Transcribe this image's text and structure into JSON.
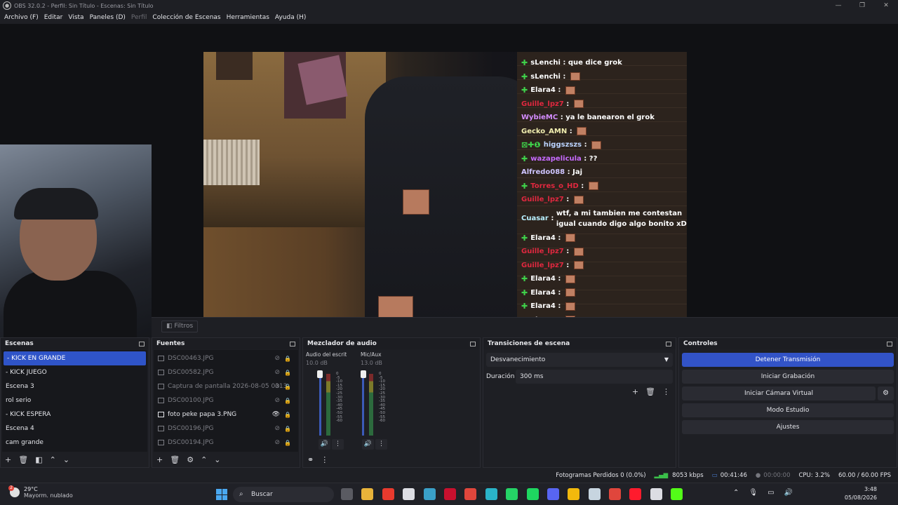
{
  "window": {
    "title": "OBS 32.0.2 - Perfil: Sin Título - Escenas: Sin Título",
    "controls": [
      "—",
      "❐",
      "✕"
    ]
  },
  "menu": {
    "items": [
      "Archivo (F)",
      "Editar",
      "Vista",
      "Paneles (D)",
      "Perfil",
      "Colección de Escenas",
      "Herramientas",
      "Ayuda (H)"
    ]
  },
  "chat": {
    "lines": [
      {
        "user": "sLenchi",
        "msg": "que dice grok",
        "color": "#ffffff",
        "badge": "✚",
        "emote": false
      },
      {
        "user": "sLenchi",
        "msg": "",
        "color": "#ffffff",
        "badge": "✚",
        "emote": true
      },
      {
        "user": "Elara4",
        "msg": "",
        "color": "#ffffff",
        "badge": "✚",
        "emote": true
      },
      {
        "user": "Guille_lpz7",
        "msg": "",
        "color": "#e0283f",
        "badge": "",
        "emote": true
      },
      {
        "user": "WybieMC",
        "msg": "ya le banearon el grok",
        "color": "#d48cff",
        "badge": "",
        "emote": false
      },
      {
        "user": "Gecko_AMN",
        "msg": "",
        "color": "#f2efb0",
        "badge": "",
        "emote": true
      },
      {
        "user": "higgszszs",
        "msg": "",
        "color": "#bcd4ff",
        "badge": "⊠✚❶",
        "emote": true
      },
      {
        "user": "wazapelicula",
        "msg": "??",
        "color": "#c76bff",
        "badge": "✚",
        "emote": false
      },
      {
        "user": "Alfredo088",
        "msg": "Jaj",
        "color": "#cfc5ff",
        "badge": "",
        "emote": false
      },
      {
        "user": "Torres_o_HD",
        "msg": "",
        "color": "#e0283f",
        "badge": "✚",
        "emote": true
      },
      {
        "user": "Guille_lpz7",
        "msg": "",
        "color": "#e0283f",
        "badge": "",
        "emote": true
      },
      {
        "user": "Cuasar",
        "msg": "wtf, a mi tambien me contestan igual cuando digo algo bonito xD",
        "color": "#b8f0ff",
        "badge": "",
        "emote": false
      },
      {
        "user": "Elara4",
        "msg": "",
        "color": "#ffffff",
        "badge": "✚",
        "emote": true
      },
      {
        "user": "Guille_lpz7",
        "msg": "",
        "color": "#e0283f",
        "badge": "",
        "emote": true
      },
      {
        "user": "Guille_lpz7",
        "msg": "",
        "color": "#e0283f",
        "badge": "",
        "emote": true
      },
      {
        "user": "Elara4",
        "msg": "",
        "color": "#ffffff",
        "badge": "✚",
        "emote": true
      },
      {
        "user": "Elara4",
        "msg": "",
        "color": "#ffffff",
        "badge": "✚",
        "emote": true
      },
      {
        "user": "Elara4",
        "msg": "",
        "color": "#ffffff",
        "badge": "✚",
        "emote": true
      },
      {
        "user": "Elara4",
        "msg": "",
        "color": "#ffffff",
        "badge": "✚",
        "emote": true
      }
    ]
  },
  "filters_button": "Filtros",
  "scenes": {
    "title": "Escenas",
    "items": [
      {
        "label": "- KICK EN GRANDE",
        "active": true
      },
      {
        "label": "- KICK JUEGO",
        "active": false
      },
      {
        "label": "Escena 3",
        "active": false
      },
      {
        "label": "rol serio",
        "active": false
      },
      {
        "label": "- KICK ESPERA",
        "active": false
      },
      {
        "label": "Escena 4",
        "active": false
      },
      {
        "label": "cam grande",
        "active": false
      }
    ]
  },
  "sources": {
    "title": "Fuentes",
    "items": [
      {
        "label": "DSC00463.JPG",
        "visible": false
      },
      {
        "label": "DSC00582.JPG",
        "visible": false
      },
      {
        "label": "Captura de pantalla 2026-08-05 0313",
        "visible": false
      },
      {
        "label": "DSC00100.JPG",
        "visible": false
      },
      {
        "label": "foto peke papa 3.PNG",
        "visible": true
      },
      {
        "label": "DSC00196.JPG",
        "visible": false
      },
      {
        "label": "DSC00194.JPG",
        "visible": false
      }
    ]
  },
  "mixer": {
    "title": "Mezclador de audio",
    "channels": [
      {
        "name": "Audio del escritorio",
        "db": "10.0 dB"
      },
      {
        "name": "Mic/Aux",
        "db": "13.0 dB"
      }
    ],
    "ticks": [
      "0",
      "-5",
      "-10",
      "-15",
      "-20",
      "-25",
      "-30",
      "-35",
      "-40",
      "-45",
      "-50",
      "-55",
      "-60"
    ]
  },
  "transitions": {
    "title": "Transiciones de escena",
    "selected": "Desvanecimiento",
    "duration_label": "Duración",
    "duration_value": "300 ms"
  },
  "controls": {
    "title": "Controles",
    "stop_stream": "Detener Transmisión",
    "start_record": "Iniciar Grabación",
    "virtual_cam": "Iniciar Cámara Virtual",
    "studio_mode": "Modo Estudio",
    "settings": "Ajustes"
  },
  "status": {
    "dropped_frames": "Fotogramas Perdidos 0 (0.0%)",
    "bitrate": "8053 kbps",
    "stream_time": "00:41:46",
    "record_time": "00:00:00",
    "cpu": "CPU: 3.2%",
    "fps": "60.00 / 60.00 FPS"
  },
  "taskbar": {
    "temperature": "29°C",
    "weather": "Mayorm. nublado",
    "weather_badge": "2",
    "search_placeholder": "Buscar",
    "time": "3:48",
    "date": "05/08/2026",
    "app_colors": [
      "#5a5b62",
      "#e8b33a",
      "#e83a2e",
      "#dcdde3",
      "#3aa0c8",
      "#c8102e",
      "#e0463c",
      "#2ab3c8",
      "#25d366",
      "#1ed760",
      "#5865f2",
      "#f2b90c",
      "#c7d5e0",
      "#e0463c",
      "#ff1b2d",
      "#dcdde3",
      "#53fc18"
    ]
  }
}
